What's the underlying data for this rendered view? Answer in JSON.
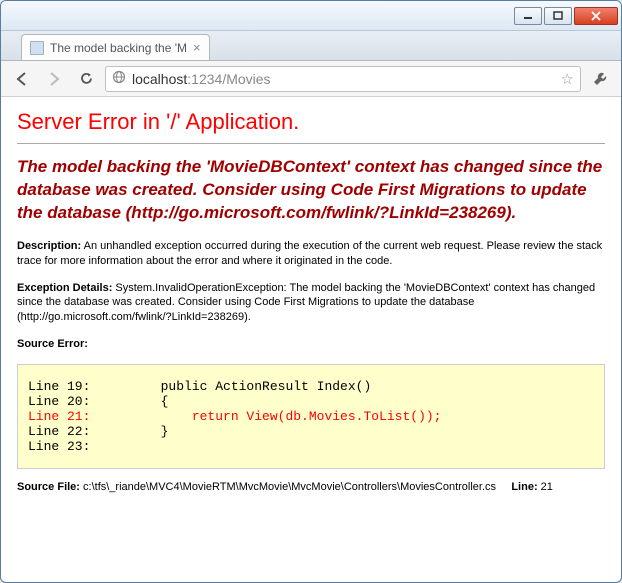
{
  "tab": {
    "title": "The model backing the 'M"
  },
  "url": {
    "host": "localhost",
    "port": "1234",
    "path": "/Movies"
  },
  "error": {
    "title": "Server Error in '/' Application.",
    "message": "The model backing the 'MovieDBContext' context has changed since the database was created. Consider using Code First Migrations to update the database (http://go.microsoft.com/fwlink/?LinkId=238269).",
    "description_label": "Description:",
    "description_text": " An unhandled exception occurred during the execution of the current web request. Please review the stack trace for more information about the error and where it originated in the code.",
    "details_label": "Exception Details:",
    "details_text": " System.InvalidOperationException: The model backing the 'MovieDBContext' context has changed since the database was created. Consider using Code First Migrations to update the database (http://go.microsoft.com/fwlink/?LinkId=238269).",
    "source_error_label": "Source Error:",
    "source_lines": {
      "l19": "Line 19:         public ActionResult Index()",
      "l20": "Line 20:         {",
      "l21": "Line 21:             return View(db.Movies.ToList());",
      "l22": "Line 22:         }",
      "l23": "Line 23:"
    },
    "source_file_label": "Source File:",
    "source_file_text": " c:\\tfs\\_riande\\MVC4\\MovieRTM\\MvcMovie\\MvcMovie\\Controllers\\MoviesController.cs",
    "line_label": "Line:",
    "line_num": " 21"
  }
}
